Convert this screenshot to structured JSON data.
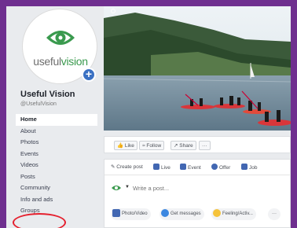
{
  "page": {
    "logo_useful": "useful",
    "logo_vision": "vision",
    "name": "Useful Vision",
    "handle": "@UsefulVision",
    "add_symbol": "+"
  },
  "nav": {
    "home": "Home",
    "about": "About",
    "photos": "Photos",
    "events": "Events",
    "videos": "Videos",
    "posts": "Posts",
    "community": "Community",
    "info_ads": "Info and ads",
    "groups": "Groups"
  },
  "actions": {
    "like": "Like",
    "follow": "Follow",
    "share": "Share",
    "more": "···"
  },
  "composer": {
    "create_post": "Create post",
    "live": "Live",
    "event": "Event",
    "offer": "Offer",
    "job": "Job",
    "placeholder": "Write a post...",
    "photo_video": "Photo/Video",
    "get_messages": "Get messages",
    "feeling": "Feeling/Activ...",
    "more": "···"
  },
  "colors": {
    "frame": "#6f2f8f",
    "brand_green": "#3a9a4e",
    "facebook_blue": "#4267b2",
    "highlight_red": "#e5202e"
  },
  "icons": {
    "logo": "eye-logo-icon",
    "add": "plus-badge-icon",
    "like": "thumbs-up-icon",
    "follow": "rss-icon",
    "share": "share-arrow-icon",
    "create_post": "pencil-icon",
    "live": "video-camera-icon",
    "event": "calendar-icon",
    "offer": "tag-icon",
    "job": "briefcase-icon",
    "photo": "photo-icon",
    "messenger": "messenger-icon",
    "feeling": "smiley-icon"
  }
}
